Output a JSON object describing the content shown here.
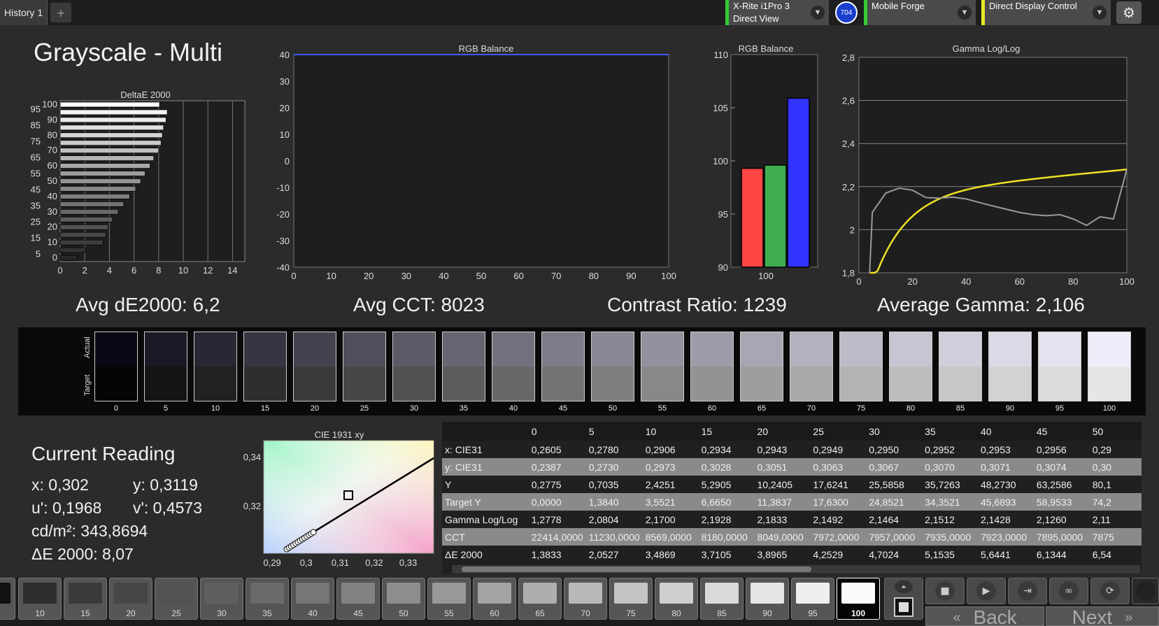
{
  "tabs": {
    "history_label": "History 1",
    "add_label": "+"
  },
  "devices": [
    {
      "line1": "X-Rite i1Pro 3",
      "line2": "Direct View",
      "accent": "#33cc33"
    },
    {
      "line1": "Mobile Forge",
      "line2": "",
      "accent": "#33cc33"
    },
    {
      "line1": "Direct Display Control",
      "line2": "",
      "accent": "#e8e82a"
    }
  ],
  "badge": "704",
  "icons": {
    "settings": "gear-icon",
    "dropdown": "chevron-down-icon"
  },
  "page_title": "Grayscale - Multi",
  "stats": {
    "avg_de": "Avg dE2000: 6,2",
    "avg_cct": "Avg CCT: 8023",
    "contrast": "Contrast Ratio: 1239",
    "avg_gamma": "Average Gamma: 2,106"
  },
  "chart_data": [
    {
      "type": "bar",
      "orientation": "horizontal",
      "title": "DeltaE 2000",
      "categories": [
        "0",
        "5",
        "10",
        "15",
        "20",
        "25",
        "30",
        "35",
        "40",
        "45",
        "50",
        "55",
        "60",
        "65",
        "70",
        "75",
        "80",
        "85",
        "90",
        "95",
        "100"
      ],
      "values": [
        1.3833,
        2.0527,
        3.4869,
        3.7105,
        3.8965,
        4.2529,
        4.7024,
        5.1535,
        5.6441,
        6.1344,
        6.54,
        6.9,
        7.3,
        7.6,
        8.0,
        8.2,
        8.3,
        8.4,
        8.6,
        8.7,
        8.07
      ],
      "xlim": [
        0,
        15
      ],
      "xticks": [
        "0",
        "2",
        "4",
        "6",
        "8",
        "10",
        "12",
        "14"
      ],
      "yticks_left": [
        "95",
        "85",
        "75",
        "65",
        "55",
        "45",
        "35",
        "25",
        "15",
        "5"
      ],
      "yticks_right": [
        "100",
        "90",
        "80",
        "70",
        "60",
        "50",
        "40",
        "30",
        "20",
        "10",
        "0"
      ]
    },
    {
      "type": "line",
      "title": "RGB Balance",
      "x": [
        0,
        100
      ],
      "series": [
        {
          "values": [
            40,
            40
          ],
          "color": "#3b5bff"
        }
      ],
      "ylim": [
        -40,
        40
      ],
      "xlim": [
        0,
        100
      ],
      "xticks": [
        "0",
        "10",
        "20",
        "30",
        "40",
        "50",
        "60",
        "70",
        "80",
        "90",
        "100"
      ],
      "yticks": [
        "40",
        "30",
        "20",
        "10",
        "0",
        "-10",
        "-20",
        "-30",
        "-40"
      ]
    },
    {
      "type": "bar",
      "title": "RGB Balance",
      "categories": [
        "100"
      ],
      "series": [
        {
          "values": [
            99.3
          ],
          "color": "#ff4444"
        },
        {
          "values": [
            99.6
          ],
          "color": "#3fae4f"
        },
        {
          "values": [
            105.9
          ],
          "color": "#3333ff"
        }
      ],
      "ylim": [
        90,
        110
      ],
      "yticks": [
        "110",
        "105",
        "100",
        "95",
        "90"
      ]
    },
    {
      "type": "line",
      "title": "Gamma Log/Log",
      "x": [
        5,
        10,
        15,
        20,
        25,
        30,
        35,
        40,
        45,
        50,
        55,
        60,
        65,
        70,
        75,
        80,
        85,
        90,
        95,
        100
      ],
      "series": [
        {
          "values": [
            2.0804,
            2.17,
            2.1928,
            2.1833,
            2.1492,
            2.1464,
            2.1512,
            2.1428,
            2.126,
            2.11,
            2.095,
            2.08,
            2.07,
            2.065,
            2.07,
            2.05,
            2.02,
            2.06,
            2.05,
            2.28
          ],
          "color": "#9a9a9a"
        },
        {
          "target": "curve",
          "color": "#f0e020"
        }
      ],
      "ylim": [
        1.8,
        2.8
      ],
      "xlim": [
        0,
        100
      ],
      "xticks": [
        "0",
        "20",
        "40",
        "60",
        "80",
        "100"
      ],
      "yticks": [
        "2,8",
        "2,6",
        "2,4",
        "2,2",
        "2",
        "1,8"
      ]
    },
    {
      "type": "scatter",
      "title": "CIE 1931 xy",
      "xticks": [
        "0,29",
        "0,3",
        "0,31",
        "0,32",
        "0,33"
      ],
      "yticks": [
        "0,34",
        "0,32"
      ],
      "points_x": [
        0.2905,
        0.292,
        0.293,
        0.2934,
        0.2943,
        0.2949,
        0.295,
        0.2952,
        0.2953,
        0.2956,
        0.297,
        0.299,
        0.3
      ],
      "points_y": [
        0.3093,
        0.3098,
        0.31,
        0.3028,
        0.3051,
        0.3063,
        0.3067,
        0.307,
        0.3071,
        0.3074,
        0.3078,
        0.3082,
        0.3085
      ],
      "target_point": [
        0.3127,
        0.329
      ]
    }
  ],
  "strip": {
    "label_actual": "Actual",
    "label_target": "Target",
    "levels": [
      "0",
      "5",
      "10",
      "15",
      "20",
      "25",
      "30",
      "35",
      "40",
      "45",
      "50",
      "55",
      "60",
      "65",
      "70",
      "75",
      "80",
      "85",
      "90",
      "95",
      "100"
    ]
  },
  "reading": {
    "title": "Current Reading",
    "x": "x: 0,302",
    "y": "y: 0,3119",
    "u": "u': 0,1968",
    "v": "v': 0,4573",
    "cd": "cd/m²: 343,8694",
    "de": "ΔE 2000: 8,07"
  },
  "table": {
    "columns": [
      "0",
      "5",
      "10",
      "15",
      "20",
      "25",
      "30",
      "35",
      "40",
      "45",
      "50"
    ],
    "rows": [
      {
        "label": "x: CIE31",
        "values": [
          "0,2605",
          "0,2780",
          "0,2906",
          "0,2934",
          "0,2943",
          "0,2949",
          "0,2950",
          "0,2952",
          "0,2953",
          "0,2956",
          "0,29"
        ]
      },
      {
        "label": "y: CIE31",
        "values": [
          "0,2387",
          "0,2730",
          "0,2973",
          "0,3028",
          "0,3051",
          "0,3063",
          "0,3067",
          "0,3070",
          "0,3071",
          "0,3074",
          "0,30"
        ]
      },
      {
        "label": "Y",
        "values": [
          "0,2775",
          "0,7035",
          "2,4251",
          "5,2905",
          "10,2405",
          "17,6241",
          "25,5858",
          "35,7263",
          "48,2730",
          "63,2586",
          "80,1"
        ]
      },
      {
        "label": "Target Y",
        "values": [
          "0,0000",
          "1,3840",
          "3,5521",
          "6,6650",
          "11,3837",
          "17,6300",
          "24,8521",
          "34,3521",
          "45,6893",
          "58,9533",
          "74,2"
        ]
      },
      {
        "label": "Gamma Log/Log",
        "values": [
          "1,2778",
          "2,0804",
          "2,1700",
          "2,1928",
          "2,1833",
          "2,1492",
          "2,1464",
          "2,1512",
          "2,1428",
          "2,1260",
          "2,11"
        ]
      },
      {
        "label": "CCT",
        "values": [
          "22414,0000",
          "11230,0000",
          "8569,0000",
          "8180,0000",
          "8049,0000",
          "7972,0000",
          "7957,0000",
          "7935,0000",
          "7923,0000",
          "7895,0000",
          "7875"
        ]
      },
      {
        "label": "ΔE 2000",
        "values": [
          "1,3833",
          "2,0527",
          "3,4869",
          "3,7105",
          "3,8965",
          "4,2529",
          "4,7024",
          "5,1535",
          "5,6441",
          "6,1344",
          "6,54"
        ]
      }
    ]
  },
  "bottom": {
    "swatches": [
      "10",
      "15",
      "20",
      "25",
      "30",
      "35",
      "40",
      "45",
      "50",
      "55",
      "60",
      "65",
      "70",
      "75",
      "80",
      "85",
      "90",
      "95",
      "100"
    ],
    "active": "100",
    "back_label": "Back",
    "next_label": "Next",
    "controls": [
      "stop-icon",
      "play-icon",
      "step-icon",
      "loop-icon",
      "refresh-icon"
    ]
  }
}
